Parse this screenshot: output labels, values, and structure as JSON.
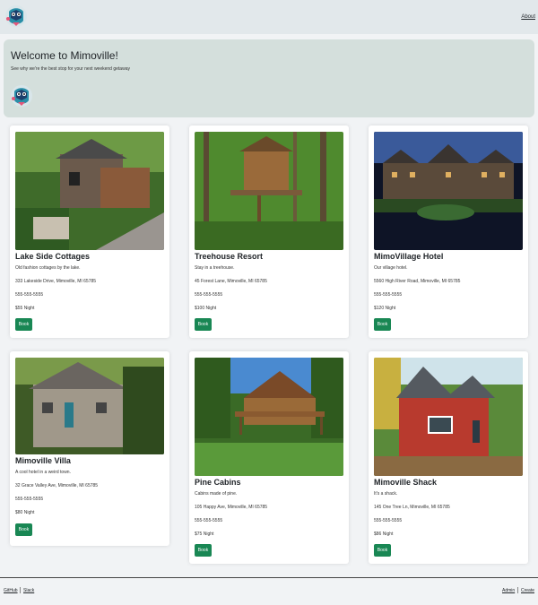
{
  "nav": {
    "about_label": "About"
  },
  "hero": {
    "title": "Welcome to Mimoville!",
    "subtitle": "See why we're the best stop for your next weekend getaway"
  },
  "cards": [
    {
      "title": "Lake Side Cottages",
      "desc": "Old fashion cottages by the lake.",
      "address": "333 Lakeside Drive, Mimoville, MI 65785",
      "phone": "555-555-5555",
      "price": "$55 Night",
      "book": "Book"
    },
    {
      "title": "Treehouse Resort",
      "desc": "Stay in a treehouse.",
      "address": "45 Forest Lane, Mimoville, MI 65785",
      "phone": "555-555-5555",
      "price": "$100 Night",
      "book": "Book"
    },
    {
      "title": "MimoVillage Hotel",
      "desc": "Our village hotel.",
      "address": "5560 High River Road, Mimoville, MI 65785",
      "phone": "555-555-5555",
      "price": "$120 Night",
      "book": "Book"
    },
    {
      "title": "Mimoville Villa",
      "desc": "A cool hotel in a weird town.",
      "address": "32 Grace Valley Ave, Mimoville, MI 65785",
      "phone": "555-555-5555",
      "price": "$80 Night",
      "book": "Book"
    },
    {
      "title": "Pine Cabins",
      "desc": "Cabins made of pine.",
      "address": "105 Happy Ave, Mimoville, MI 65785",
      "phone": "555-555-5555",
      "price": "$75 Night",
      "book": "Book"
    },
    {
      "title": "Mimoville Shack",
      "desc": "It's a shack.",
      "address": "145 One Tree Ln, Mimoville, MI 65785",
      "phone": "555-555-5555",
      "price": "$86 Night",
      "book": "Book"
    }
  ],
  "footer": {
    "github": "GitHub",
    "slack": "Slack",
    "admin": "Admin",
    "create": "Create"
  },
  "colors": {
    "accent": "#198754",
    "hero_bg": "#d4dfdc",
    "nav_bg": "#e2e8eb"
  }
}
